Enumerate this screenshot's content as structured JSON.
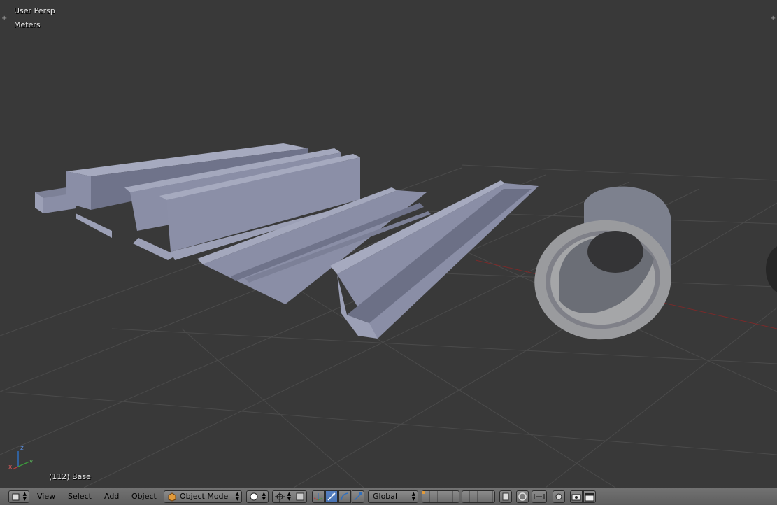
{
  "viewport": {
    "view_name": "User Persp",
    "units": "Meters",
    "object_info": "(112) Base"
  },
  "header": {
    "editor_type_icon": "3d-viewport-icon",
    "menus": [
      "View",
      "Select",
      "Add",
      "Object"
    ],
    "mode": "Object Mode",
    "shading_icon": "solid-shading-icon",
    "pivot_icon": "pivot-point-icon",
    "transform_orientation": "Global",
    "icons": [
      "manipulator-icon",
      "translate-icon",
      "rotate-icon",
      "scale-icon",
      "layers-icon",
      "lock-icon",
      "proportional-icon",
      "snap-icon",
      "snap-target-icon",
      "render-icon",
      "clapper-icon"
    ]
  },
  "colors": {
    "viewport_bg": "#393939",
    "grid": "#4a4a4a",
    "x_axis": "#7a2a2a",
    "mesh": "#8a8ea6",
    "header_bg": "#6b6b6b",
    "accent": "#5680c2"
  }
}
